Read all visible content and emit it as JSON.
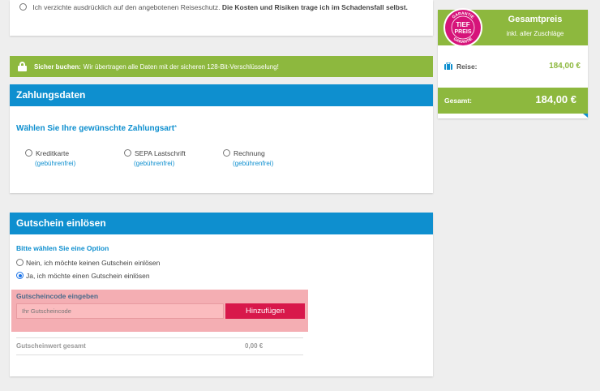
{
  "insurance": {
    "decline_text": "Ich verzichte ausdrücklich auf den angebotenen Reiseschutz.",
    "decline_bold": "Die Kosten und Risiken trage ich im Schadensfall selbst."
  },
  "secure_banner": {
    "bold": "Sicher buchen:",
    "text": "Wir übertragen alle Daten mit der sicheren 128-Bit-Verschlüsselung!"
  },
  "payment": {
    "title": "Zahlungsdaten",
    "question": "Wählen Sie Ihre gewünschte Zahlungsart",
    "required_mark": "*",
    "options": [
      {
        "label": "Kreditkarte",
        "fee": "(gebührenfrei)"
      },
      {
        "label": "SEPA Lastschrift",
        "fee": "(gebührenfrei)"
      },
      {
        "label": "Rechnung",
        "fee": "(gebührenfrei)"
      }
    ]
  },
  "voucher": {
    "title": "Gutschein einlösen",
    "subtitle": "Bitte wählen Sie eine Option",
    "option_no": "Nein, ich möchte keinen Gutschein einlösen",
    "option_yes": "Ja, ich möchte einen Gutschein einlösen",
    "code_title": "Gutscheincode eingeben",
    "code_placeholder": "Ihr Gutscheincode",
    "add_button": "Hinzufügen",
    "total_label": "Gutscheinwert gesamt",
    "total_value": "0,00 €"
  },
  "price_panel": {
    "title": "Gesamtpreis",
    "subtitle": "inkl. aller Zuschläge",
    "badge_top": "GARANTIE",
    "badge_line1": "TIEF",
    "badge_line2": "PREIS",
    "badge_bottom": "GARANTIE",
    "trip_label": "Reise:",
    "trip_value": "184,00 €",
    "total_label": "Gesamt:",
    "total_value": "184,00 €"
  },
  "colors": {
    "green": "#8db83e",
    "blue": "#0e8fcf",
    "pink_button": "#d8184b",
    "badge": "#d6147a"
  }
}
